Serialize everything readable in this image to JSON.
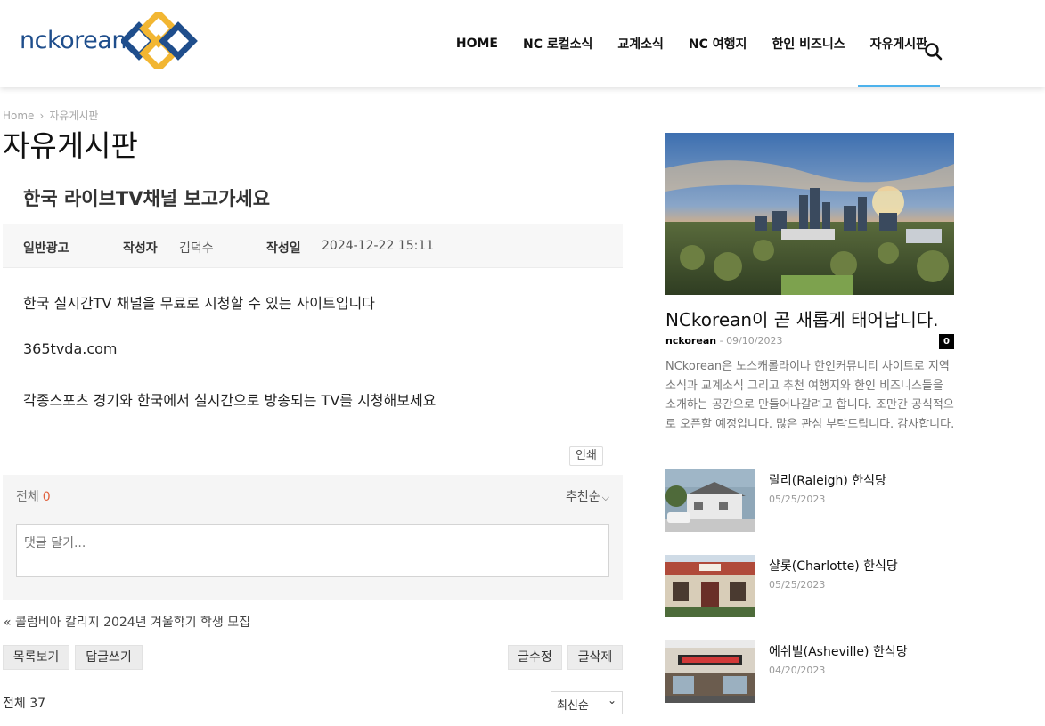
{
  "site": {
    "logo_text": "nckorean",
    "nav": [
      "HOME",
      "NC 로컬소식",
      "교계소식",
      "NC 여행지",
      "한인 비즈니스",
      "자유게시판"
    ],
    "active_nav_index": 5,
    "accent": "#4db2ec"
  },
  "breadcrumb": {
    "home": "Home",
    "sep": "›",
    "current": "자유게시판"
  },
  "page_title": "자유게시판",
  "post": {
    "title": "한국 라이브TV채널 보고가세요",
    "category": "일반광고",
    "author_label": "작성자",
    "author": "김덕수",
    "date_label": "작성일",
    "date": "2024-12-22 15:11",
    "paragraphs": [
      "한국 실시간TV 채널을 무료로 시청할 수 있는 사이트입니다",
      "365tvda.com",
      "각종스포츠 경기와 한국에서 실시간으로 방송되는 TV를 시청해보세요"
    ],
    "print_label": "인쇄"
  },
  "comments": {
    "total_label": "전체",
    "count": "0",
    "sort_label": "추천순",
    "placeholder": "댓글 달기..."
  },
  "prev_post": "« 콜럼비아 칼리지 2024년 겨울학기 학생 모집",
  "buttons": {
    "list": "목록보기",
    "reply": "답글쓰기",
    "edit": "글수정",
    "delete": "글삭제"
  },
  "board": {
    "total_label": "전체 37",
    "sort_value": "최신순"
  },
  "sidebar": {
    "hero": {
      "title": "NCkorean이 곧 새롭게 태어납니다.",
      "author": "nckorean",
      "sep": "-",
      "date": "09/10/2023",
      "comment_count": "0",
      "excerpt": "NCkorean은 노스캐롤라이나 한인커뮤니티 사이트로 지역소식과 교계소식 그리고 추천 여행지와 한인 비즈니스들을 소개하는 공간으로 만들어나갈려고 합니다. 조만간 공식적으로 오픈할 예정입니다. 많은 관심 부탁드립니다. 감사합니다."
    },
    "items": [
      {
        "title": "랄리(Raleigh) 한식당",
        "date": "05/25/2023"
      },
      {
        "title": "샬롯(Charlotte) 한식당",
        "date": "05/25/2023"
      },
      {
        "title": "에쉬빌(Asheville) 한식당",
        "date": "04/20/2023"
      }
    ]
  }
}
